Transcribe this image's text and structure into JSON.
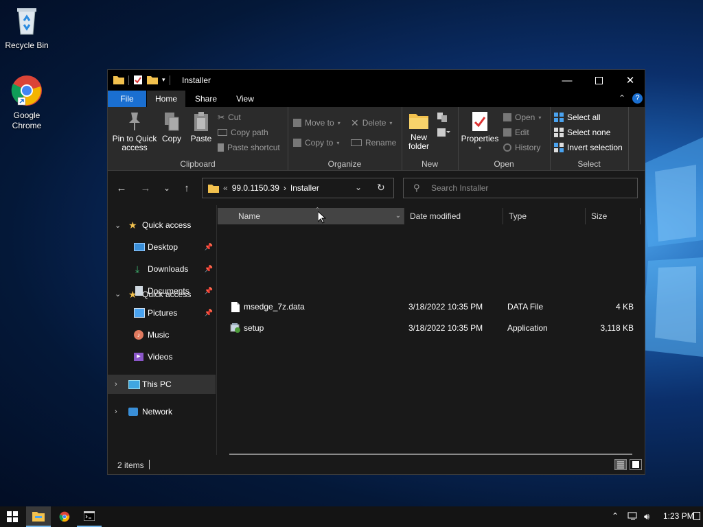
{
  "desktop": {
    "icons": [
      {
        "label": "Recycle Bin"
      },
      {
        "label": "Google Chrome"
      }
    ]
  },
  "window": {
    "title": "Installer",
    "tabs": {
      "file": "File",
      "home": "Home",
      "share": "Share",
      "view": "View"
    },
    "ribbon": {
      "clipboard": {
        "label": "Clipboard",
        "pin": "Pin to Quick access",
        "copy": "Copy",
        "paste": "Paste",
        "cut": "Cut",
        "copy_path": "Copy path",
        "paste_shortcut": "Paste shortcut"
      },
      "organize": {
        "label": "Organize",
        "move_to": "Move to",
        "copy_to": "Copy to",
        "delete": "Delete",
        "rename": "Rename"
      },
      "new": {
        "label": "New",
        "new_folder": "New folder"
      },
      "open": {
        "label": "Open",
        "properties": "Properties",
        "open": "Open",
        "edit": "Edit",
        "history": "History"
      },
      "select": {
        "label": "Select",
        "select_all": "Select all",
        "select_none": "Select none",
        "invert_selection": "Invert selection"
      }
    },
    "address": {
      "overflow": "«",
      "parent": "99.0.1150.39",
      "separator": "›",
      "current": "Installer"
    },
    "search": {
      "placeholder": "Search Installer"
    },
    "nav": {
      "quick_access": "Quick access",
      "desktop": "Desktop",
      "downloads": "Downloads",
      "documents": "Documents",
      "pictures": "Pictures",
      "music": "Music",
      "videos": "Videos",
      "this_pc": "This PC",
      "network": "Network"
    },
    "columns": {
      "name": "Name",
      "date": "Date modified",
      "type": "Type",
      "size": "Size"
    },
    "files": [
      {
        "name": "msedge_7z.data",
        "date": "3/18/2022 10:35 PM",
        "type": "DATA File",
        "size": "4 KB"
      },
      {
        "name": "setup",
        "date": "3/18/2022 10:35 PM",
        "type": "Application",
        "size": "3,118 KB"
      }
    ],
    "status": {
      "item_count": "2 items"
    }
  },
  "taskbar": {
    "clock": "1:23 PM"
  },
  "colors": {
    "accent": "#1a6fd1",
    "ribbon_bg": "#2b2b2b",
    "window_bg": "#191919",
    "folder_yellow": "#f2c14e"
  }
}
